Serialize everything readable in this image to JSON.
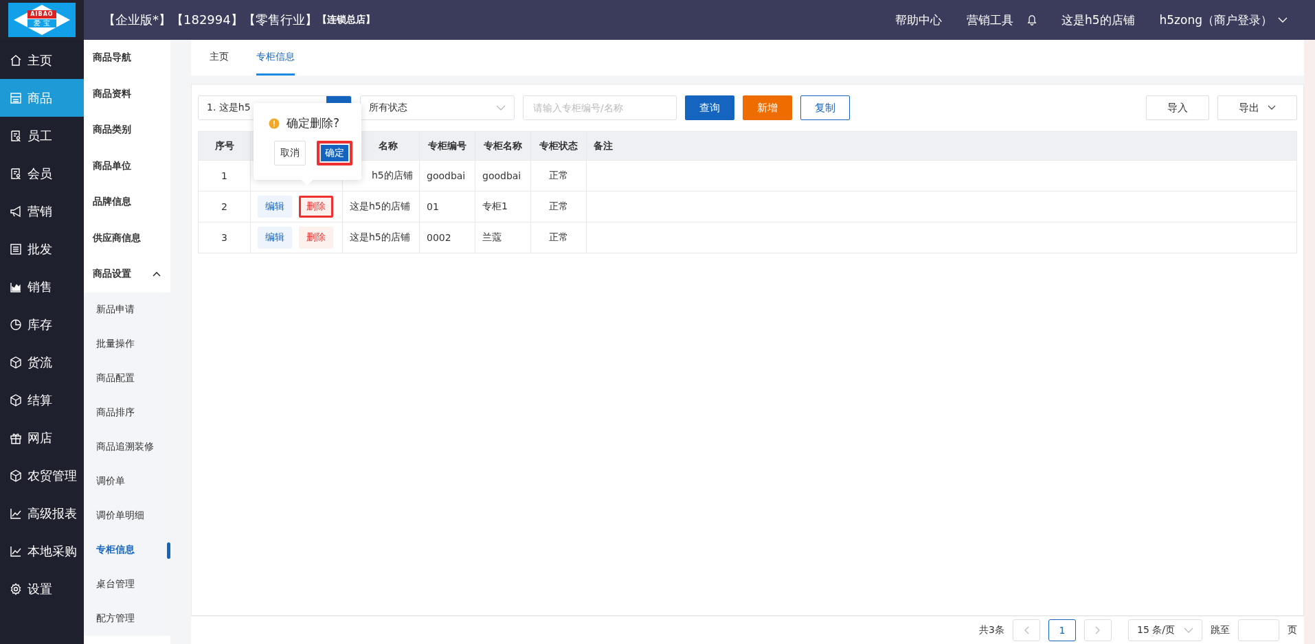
{
  "header": {
    "logo": {
      "top": "AIBAO",
      "bottom": "爱 宝"
    },
    "title_parts": [
      "【企业版*】",
      "【182994】",
      "【零售行业】"
    ],
    "title_sub": "【连锁总店】",
    "links": [
      "帮助中心",
      "营销工具"
    ],
    "store": "这是h5的店铺",
    "user": "h5zong（商户登录）"
  },
  "main_nav": [
    {
      "label": "主页",
      "selected": false
    },
    {
      "label": "商品",
      "selected": true
    },
    {
      "label": "员工",
      "selected": false
    },
    {
      "label": "会员",
      "selected": false
    },
    {
      "label": "营销",
      "selected": false
    },
    {
      "label": "批发",
      "selected": false
    },
    {
      "label": "销售",
      "selected": false
    },
    {
      "label": "库存",
      "selected": false
    },
    {
      "label": "货流",
      "selected": false
    },
    {
      "label": "结算",
      "selected": false
    },
    {
      "label": "网店",
      "selected": false
    },
    {
      "label": "农贸管理",
      "selected": false
    },
    {
      "label": "高级报表",
      "selected": false
    },
    {
      "label": "本地采购",
      "selected": false
    },
    {
      "label": "设置",
      "selected": false
    }
  ],
  "sub_nav": [
    {
      "label": "商品导航"
    },
    {
      "label": "商品资料"
    },
    {
      "label": "商品类别"
    },
    {
      "label": "商品单位"
    },
    {
      "label": "品牌信息"
    },
    {
      "label": "供应商信息"
    },
    {
      "label": "商品设置",
      "expanded": true,
      "children": [
        {
          "label": "新品申请",
          "selected": false
        },
        {
          "label": "批量操作",
          "selected": false
        },
        {
          "label": "商品配置",
          "selected": false
        },
        {
          "label": "商品排序",
          "selected": false
        },
        {
          "label": "商品追溯装修",
          "selected": false
        },
        {
          "label": "调价单",
          "selected": false
        },
        {
          "label": "调价单明细",
          "selected": false
        },
        {
          "label": "专柜信息",
          "selected": true
        },
        {
          "label": "桌台管理",
          "selected": false
        },
        {
          "label": "配方管理",
          "selected": false
        }
      ]
    }
  ],
  "tabs": [
    {
      "label": "主页",
      "selected": false
    },
    {
      "label": "专柜信息",
      "selected": true
    }
  ],
  "toolbar": {
    "store_select": "1. 这是h5",
    "status_select": "所有状态",
    "search": {
      "placeholder": "请输入专柜编号/名称"
    },
    "buttons": [
      {
        "label": "查询",
        "kind": "primary"
      },
      {
        "label": "新增",
        "kind": "warning"
      },
      {
        "label": "复制",
        "kind": "outline"
      }
    ],
    "right_buttons": [
      {
        "label": "导入",
        "dropdown": false
      },
      {
        "label": "导出",
        "dropdown": true
      }
    ]
  },
  "table": {
    "columns": [
      {
        "label": "序号"
      },
      {},
      {
        "label": "名称"
      },
      {
        "label": "专柜编号"
      },
      {
        "label": "专柜名称"
      },
      {
        "label": "专柜状态"
      },
      {
        "label": "备注"
      }
    ],
    "rows": [
      {
        "index": "1",
        "actions": [],
        "store": "h5的店铺",
        "code": "goodbai",
        "name": "goodbai",
        "status": "正常"
      },
      {
        "index": "2",
        "actions": [
          {
            "label": "编辑",
            "kind": "edit",
            "highlighted": false
          },
          {
            "label": "删除",
            "kind": "delete",
            "highlighted": true
          }
        ],
        "store": "这是h5的店铺",
        "code": "01",
        "name": "专柜1",
        "status": "正常"
      },
      {
        "index": "3",
        "actions": [
          {
            "label": "编辑",
            "kind": "edit",
            "highlighted": false
          },
          {
            "label": "删除",
            "kind": "delete",
            "highlighted": false
          }
        ],
        "store": "这是h5的店铺",
        "code": "0002",
        "name": "兰蔻",
        "status": "正常"
      }
    ]
  },
  "popconfirm": {
    "message": "确定删除?",
    "cancel": "取消",
    "confirm": {
      "label": "确定",
      "highlighted": true
    }
  },
  "pagination": {
    "total": "共3条",
    "pages": [
      {
        "label": "1",
        "selected": true
      }
    ],
    "page_size": "15 条/页",
    "jump_label": "跳至",
    "page_unit": "页"
  }
}
